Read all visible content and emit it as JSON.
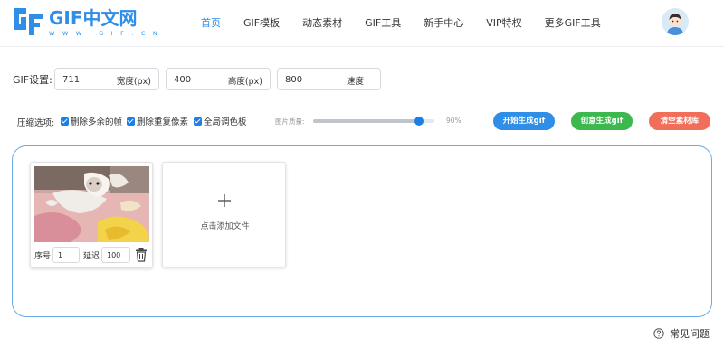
{
  "logo": {
    "title": "GIF中文网",
    "subtitle": "W W W . G I F . C N"
  },
  "nav": {
    "items": [
      "首页",
      "GIF模板",
      "动态素材",
      "GIF工具",
      "新手中心",
      "VIP特权",
      "更多GIF工具"
    ],
    "active_index": 0
  },
  "gif_settings": {
    "label": "GIF设置:",
    "width": {
      "value": "711",
      "unit": "宽度(px)"
    },
    "height": {
      "value": "400",
      "unit": "高度(px)"
    },
    "speed": {
      "value": "800",
      "unit": "速度"
    }
  },
  "compression": {
    "label": "压缩选项:",
    "options": [
      {
        "label": "删除多余的帧",
        "checked": true
      },
      {
        "label": "删除重复像素",
        "checked": true
      },
      {
        "label": "全局调色板",
        "checked": true
      }
    ],
    "quality_label": "图片质量:",
    "quality_value": "90%",
    "quality_fraction": 0.9
  },
  "buttons": {
    "start": "开始生成gif",
    "create": "创意生成gif",
    "clear": "清空素材库"
  },
  "frame": {
    "index_label": "序号",
    "index_value": "1",
    "delay_label": "延迟",
    "delay_value": "100"
  },
  "add_file": {
    "label": "点击添加文件"
  },
  "footer": {
    "faq": "常见问题"
  },
  "colors": {
    "accent": "#2f8ee6",
    "start_button": "#2f8ee6",
    "create_button": "#3cb84e",
    "clear_button": "#f06e5a",
    "workspace_border": "#6aaae6"
  },
  "icons": {
    "logo": "gif-logo-icon",
    "avatar": "user-avatar",
    "trash": "trash-icon",
    "add": "plus-icon",
    "faq": "question-circle-icon"
  }
}
